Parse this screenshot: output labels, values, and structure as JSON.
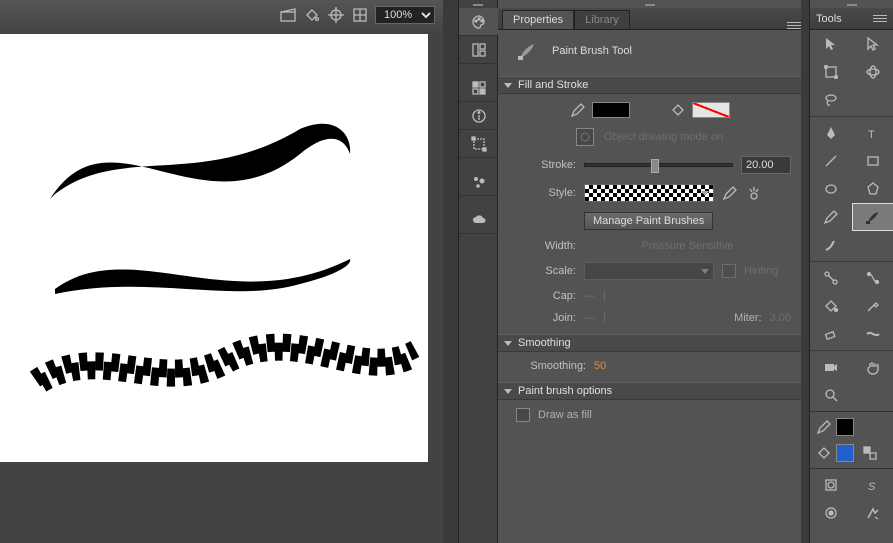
{
  "topbar": {
    "zoom": "100%"
  },
  "midstrip": {
    "icons": [
      "palette-icon",
      "layout-icon",
      "palette-alt-icon",
      "info-icon",
      "bounds-icon",
      "scatter-icon",
      "cloud-icon"
    ]
  },
  "propsPanel": {
    "tabs": {
      "active": "Properties",
      "inactive": "Library"
    },
    "toolName": "Paint Brush Tool",
    "fillStroke": {
      "title": "Fill and Stroke",
      "odm": "Object drawing mode on",
      "strokeLabel": "Stroke:",
      "strokeValue": "20.00",
      "styleLabel": "Style:",
      "manageBtn": "Manage Paint Brushes",
      "widthLabel": "Width:",
      "widthValue": "Pressure Sensitive",
      "scaleLabel": "Scale:",
      "hintingLabel": "Hinting",
      "capLabel": "Cap:",
      "joinLabel": "Join:",
      "miterLabel": "Miter:",
      "miterValue": "3.00"
    },
    "smoothing": {
      "title": "Smoothing",
      "label": "Smoothing:",
      "value": "50"
    },
    "brushOpts": {
      "title": "Paint brush options",
      "drawAsFill": "Draw as fill"
    }
  },
  "toolsPanel": {
    "title": "Tools"
  }
}
